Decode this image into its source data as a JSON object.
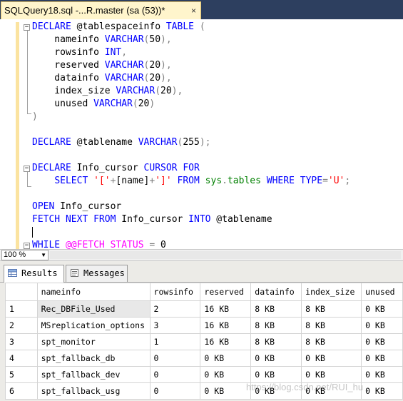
{
  "document_tab": {
    "title": "SQLQuery18.sql -...R.master (sa (53))*",
    "close": "×"
  },
  "editor": {
    "lines": [
      [
        {
          "t": "DECLARE",
          "c": "k"
        },
        {
          "t": " @tablespaceinfo ",
          "c": ""
        },
        {
          "t": "TABLE",
          "c": "k"
        },
        {
          "t": " (",
          "c": "o"
        }
      ],
      [
        {
          "t": "    nameinfo ",
          "c": ""
        },
        {
          "t": "VARCHAR",
          "c": "k"
        },
        {
          "t": "(",
          "c": "o"
        },
        {
          "t": "50",
          "c": ""
        },
        {
          "t": "),",
          "c": "o"
        }
      ],
      [
        {
          "t": "    rowsinfo ",
          "c": ""
        },
        {
          "t": "INT",
          "c": "k"
        },
        {
          "t": ",",
          "c": "o"
        }
      ],
      [
        {
          "t": "    reserved ",
          "c": ""
        },
        {
          "t": "VARCHAR",
          "c": "k"
        },
        {
          "t": "(",
          "c": "o"
        },
        {
          "t": "20",
          "c": ""
        },
        {
          "t": "),",
          "c": "o"
        }
      ],
      [
        {
          "t": "    datainfo ",
          "c": ""
        },
        {
          "t": "VARCHAR",
          "c": "k"
        },
        {
          "t": "(",
          "c": "o"
        },
        {
          "t": "20",
          "c": ""
        },
        {
          "t": "),",
          "c": "o"
        }
      ],
      [
        {
          "t": "    index_size ",
          "c": ""
        },
        {
          "t": "VARCHAR",
          "c": "k"
        },
        {
          "t": "(",
          "c": "o"
        },
        {
          "t": "20",
          "c": ""
        },
        {
          "t": "),",
          "c": "o"
        }
      ],
      [
        {
          "t": "    unused ",
          "c": ""
        },
        {
          "t": "VARCHAR",
          "c": "k"
        },
        {
          "t": "(",
          "c": "o"
        },
        {
          "t": "20",
          "c": ""
        },
        {
          "t": ")",
          "c": "o"
        }
      ],
      [
        {
          "t": ")",
          "c": "o"
        }
      ],
      [],
      [
        {
          "t": "DECLARE",
          "c": "k"
        },
        {
          "t": " @tablename ",
          "c": ""
        },
        {
          "t": "VARCHAR",
          "c": "k"
        },
        {
          "t": "(",
          "c": "o"
        },
        {
          "t": "255",
          "c": ""
        },
        {
          "t": ");",
          "c": "o"
        }
      ],
      [],
      [
        {
          "t": "DECLARE",
          "c": "k"
        },
        {
          "t": " Info_cursor ",
          "c": ""
        },
        {
          "t": "CURSOR",
          "c": "k"
        },
        {
          "t": " ",
          "c": ""
        },
        {
          "t": "FOR",
          "c": "k"
        }
      ],
      [
        {
          "t": "    ",
          "c": ""
        },
        {
          "t": "SELECT",
          "c": "k"
        },
        {
          "t": " ",
          "c": ""
        },
        {
          "t": "'['",
          "c": "s"
        },
        {
          "t": "+",
          "c": "o"
        },
        {
          "t": "[name]",
          "c": ""
        },
        {
          "t": "+",
          "c": "o"
        },
        {
          "t": "']'",
          "c": "s"
        },
        {
          "t": " ",
          "c": ""
        },
        {
          "t": "FROM",
          "c": "k"
        },
        {
          "t": " ",
          "c": ""
        },
        {
          "t": "sys",
          "c": "sy"
        },
        {
          "t": ".",
          "c": "o"
        },
        {
          "t": "tables",
          "c": "sy"
        },
        {
          "t": " ",
          "c": ""
        },
        {
          "t": "WHERE",
          "c": "k"
        },
        {
          "t": " ",
          "c": ""
        },
        {
          "t": "TYPE",
          "c": "k"
        },
        {
          "t": "=",
          "c": "o"
        },
        {
          "t": "'U'",
          "c": "s"
        },
        {
          "t": ";",
          "c": "o"
        }
      ],
      [],
      [
        {
          "t": "OPEN",
          "c": "k"
        },
        {
          "t": " Info_cursor",
          "c": ""
        }
      ],
      [
        {
          "t": "FETCH",
          "c": "k"
        },
        {
          "t": " ",
          "c": ""
        },
        {
          "t": "NEXT",
          "c": "k"
        },
        {
          "t": " ",
          "c": ""
        },
        {
          "t": "FROM",
          "c": "k"
        },
        {
          "t": " Info_cursor ",
          "c": ""
        },
        {
          "t": "INTO",
          "c": "k"
        },
        {
          "t": " @tablename",
          "c": ""
        }
      ],
      [
        {
          "t": "",
          "c": "caret"
        }
      ],
      [
        {
          "t": "WHILE",
          "c": "k"
        },
        {
          "t": " ",
          "c": ""
        },
        {
          "t": "@@FETCH_STATUS",
          "c": "f"
        },
        {
          "t": " ",
          "c": ""
        },
        {
          "t": "=",
          "c": "o"
        },
        {
          "t": " 0",
          "c": ""
        }
      ]
    ]
  },
  "zoom": {
    "value": "100 %"
  },
  "results_tabs": {
    "results": "Results",
    "messages": "Messages"
  },
  "grid": {
    "columns": [
      "nameinfo",
      "rowsinfo",
      "reserved",
      "datainfo",
      "index_size",
      "unused"
    ],
    "rows": [
      [
        "1",
        "Rec_DBFile_Used",
        "2",
        "16 KB",
        "8 KB",
        "8 KB",
        "0 KB"
      ],
      [
        "2",
        "MSreplication_options",
        "3",
        "16 KB",
        "8 KB",
        "8 KB",
        "0 KB"
      ],
      [
        "3",
        "spt_monitor",
        "1",
        "16 KB",
        "8 KB",
        "8 KB",
        "0 KB"
      ],
      [
        "4",
        "spt_fallback_db",
        "0",
        "0 KB",
        "0 KB",
        "0 KB",
        "0 KB"
      ],
      [
        "5",
        "spt_fallback_dev",
        "0",
        "0 KB",
        "0 KB",
        "0 KB",
        "0 KB"
      ],
      [
        "6",
        "spt_fallback_usg",
        "0",
        "0 KB",
        "0 KB",
        "0 KB",
        "0 KB"
      ]
    ]
  },
  "watermark": "https://blog.csdn.net/RUI_hu",
  "colors": {
    "keyword": "#0000ff",
    "string": "#ff0000",
    "operator": "#808080",
    "system_object": "#008000",
    "function": "#ff00ff",
    "tab_active": "#fff5cc",
    "tab_strip": "#2d3f5f"
  }
}
